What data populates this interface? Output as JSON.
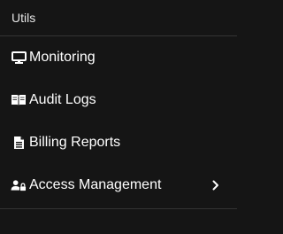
{
  "section": {
    "title": "Utils"
  },
  "nav": {
    "items": [
      {
        "label": "Monitoring",
        "icon": "desktop-icon"
      },
      {
        "label": "Audit Logs",
        "icon": "book-open-icon"
      },
      {
        "label": "Billing Reports",
        "icon": "file-text-icon"
      },
      {
        "label": "Access Management",
        "icon": "user-lock-icon",
        "expandable": true,
        "chevron_icon": "chevron-right-icon"
      }
    ]
  },
  "colors": {
    "background": "#151515",
    "text": "#ffffff",
    "divider": "#333333"
  }
}
